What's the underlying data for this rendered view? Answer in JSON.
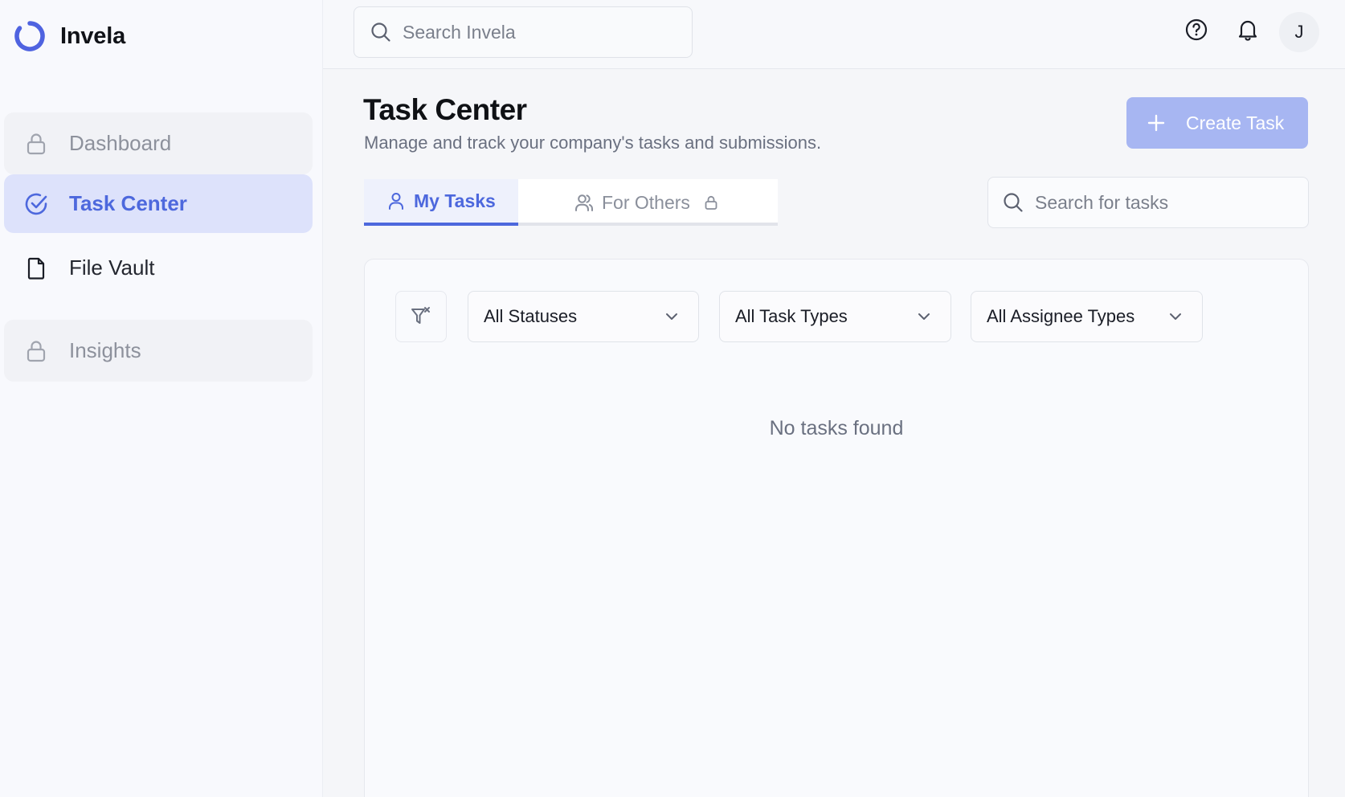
{
  "app": {
    "name": "Invela"
  },
  "sidebar": {
    "items": [
      {
        "label": "Dashboard",
        "state": "locked",
        "icon": "lock-icon"
      },
      {
        "label": "Task Center",
        "state": "active",
        "icon": "check-circle-icon"
      },
      {
        "label": "File Vault",
        "state": "normal",
        "icon": "file-icon"
      },
      {
        "label": "Insights",
        "state": "locked",
        "icon": "lock-icon"
      }
    ]
  },
  "header": {
    "search_placeholder": "Search Invela",
    "avatar_initial": "J"
  },
  "page": {
    "title": "Task Center",
    "subtitle": "Manage and track your company's tasks and submissions.",
    "create_button_label": "Create Task"
  },
  "tabs": [
    {
      "label": "My Tasks",
      "active": true
    },
    {
      "label": "For Others",
      "active": false,
      "locked": true
    }
  ],
  "task_search": {
    "placeholder": "Search for tasks"
  },
  "filters": {
    "status": "All Statuses",
    "task_type": "All Task Types",
    "assignee_type": "All Assignee Types"
  },
  "empty_state": "No tasks found",
  "colors": {
    "accent": "#4d68dd",
    "active_nav_bg": "#dde2fb",
    "create_button_bg": "#a7b6f2",
    "logo": "#4f63e0"
  }
}
